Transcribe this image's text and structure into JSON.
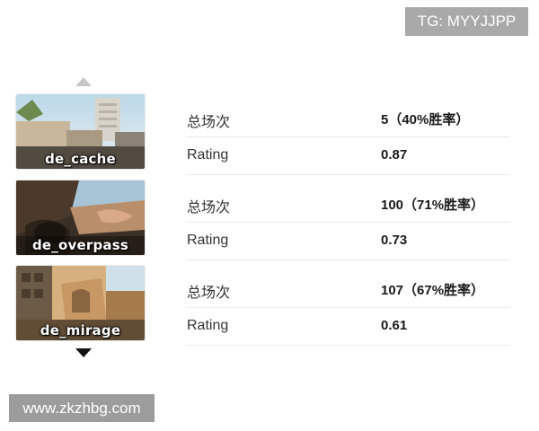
{
  "watermark_top": "TG: MYYJJPP",
  "watermark_bottom": "www.zkzhbg.com",
  "maps": [
    {
      "name": "de_cache",
      "stats": [
        {
          "label": "总场次",
          "value": "5（40%胜率）"
        },
        {
          "label": "Rating",
          "value": "0.87"
        }
      ]
    },
    {
      "name": "de_overpass",
      "stats": [
        {
          "label": "总场次",
          "value": "100（71%胜率）"
        },
        {
          "label": "Rating",
          "value": "0.73"
        }
      ]
    },
    {
      "name": "de_mirage",
      "stats": [
        {
          "label": "总场次",
          "value": "107（67%胜率）"
        },
        {
          "label": "Rating",
          "value": "0.61"
        }
      ]
    }
  ],
  "icons": {
    "scroll_up": "triangle-up-icon",
    "scroll_down": "triangle-down-icon"
  },
  "colors": {
    "arrow_up": "#c7c7c7",
    "arrow_down": "#111111",
    "watermark_bg": "#a9a9a9"
  }
}
